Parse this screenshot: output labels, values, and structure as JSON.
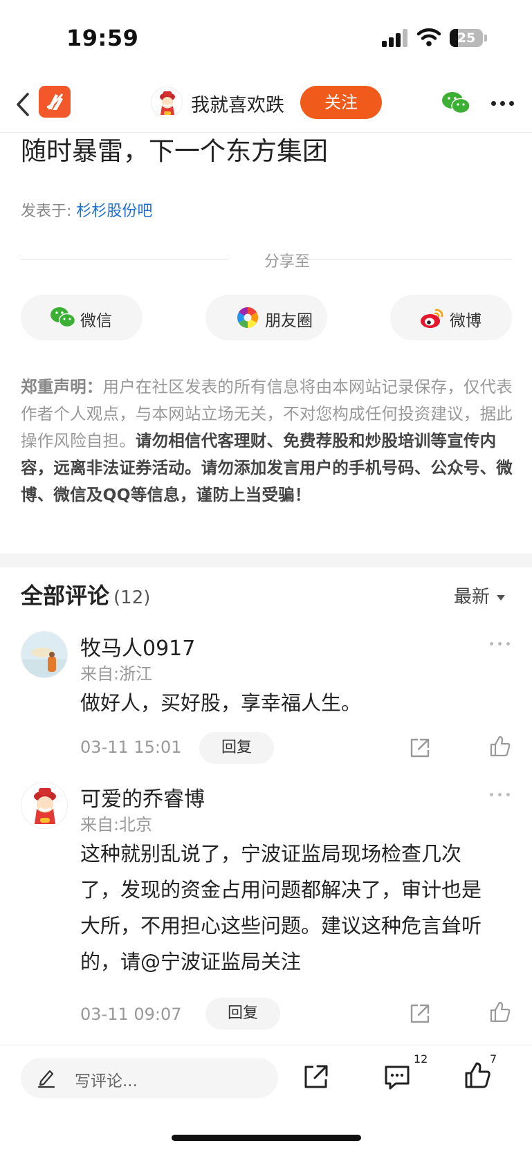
{
  "status_bar": {
    "time": "19:59",
    "battery": "25"
  },
  "nav": {
    "username": "我就喜欢跌",
    "follow_label": "关注"
  },
  "article": {
    "title": "随时暴雷，下一个东方集团",
    "posted_in_prefix": "发表于:",
    "bar_name": "杉杉股份吧"
  },
  "share": {
    "label": "分享至",
    "buttons": [
      {
        "label": "微信",
        "icon": "wechat-icon"
      },
      {
        "label": "朋友圈",
        "icon": "moments-icon"
      },
      {
        "label": "微博",
        "icon": "weibo-icon"
      }
    ]
  },
  "disclaimer": {
    "title": "郑重声明：",
    "text": "用户在社区发表的所有信息将由本网站记录保存，仅代表作者个人观点，与本网站立场无关，不对您构成任何投资建议，据此操作风险自担。",
    "warning": "请勿相信代客理财、免费荐股和炒股培训等宣传内容，远离非法证券活动。请勿添加发言用户的手机号码、公众号、微博、微信及QQ等信息，谨防上当受骗！"
  },
  "comments": {
    "title": "全部评论",
    "count": "(12)",
    "sort_label": "最新",
    "items": [
      {
        "name": "牧马人0917",
        "location": "来自:浙江",
        "text": "做好人，买好股，享幸福人生。",
        "time": "03-11 15:01",
        "reply_label": "回复"
      },
      {
        "name": "可爱的乔睿博",
        "location": "来自:北京",
        "text": "这种就别乱说了，宁波证监局现场检查几次了，发现的资金占用问题都解决了，审计也是大所，不用担心这些问题。建议这种危言耸听的，请@宁波证监局关注",
        "time": "03-11 09:07",
        "reply_label": "回复"
      }
    ]
  },
  "bottom_bar": {
    "comment_placeholder": "写评论...",
    "comment_count": "12",
    "like_count": "7"
  },
  "colors": {
    "accent": "#f05a1a",
    "link": "#1f6fd1",
    "wechat_green": "#3cb034",
    "weibo_red": "#e6162d"
  }
}
